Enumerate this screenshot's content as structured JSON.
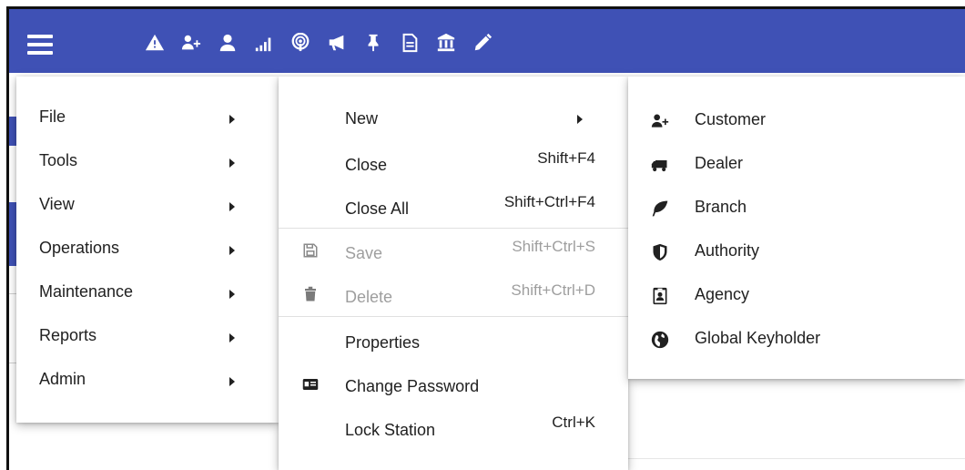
{
  "toolbar": {
    "background": "#3f51b5",
    "icons": [
      "warning-icon",
      "add-user-icon",
      "user-icon",
      "signal-icon",
      "podcast-icon",
      "bullhorn-icon",
      "thumbtack-icon",
      "document-icon",
      "bank-icon",
      "pencil-icon"
    ]
  },
  "main_menu": {
    "items": [
      {
        "label": "File",
        "has_submenu": true
      },
      {
        "label": "Tools",
        "has_submenu": true
      },
      {
        "label": "View",
        "has_submenu": true
      },
      {
        "label": "Operations",
        "has_submenu": true
      },
      {
        "label": "Maintenance",
        "has_submenu": true
      },
      {
        "label": "Reports",
        "has_submenu": true
      },
      {
        "label": "Admin",
        "has_submenu": true
      }
    ]
  },
  "file_menu": {
    "items": [
      {
        "label": "New",
        "shortcut": "",
        "icon": "",
        "disabled": false,
        "has_submenu": true
      },
      {
        "label": "Close",
        "shortcut": "Shift+F4",
        "icon": "",
        "disabled": false
      },
      {
        "label": "Close All",
        "shortcut": "Shift+Ctrl+F4",
        "icon": "",
        "disabled": false
      },
      {
        "label": "Save",
        "shortcut": "Shift+Ctrl+S",
        "icon": "save-icon",
        "disabled": true
      },
      {
        "label": "Delete",
        "shortcut": "Shift+Ctrl+D",
        "icon": "trash-icon",
        "disabled": true
      },
      {
        "label": "Properties",
        "shortcut": "",
        "icon": "",
        "disabled": false
      },
      {
        "label": "Change Password",
        "shortcut": "",
        "icon": "id-card-icon",
        "disabled": false
      },
      {
        "label": "Lock Station",
        "shortcut": "Ctrl+K",
        "icon": "",
        "disabled": false
      }
    ]
  },
  "new_menu": {
    "items": [
      {
        "label": "Customer",
        "icon": "add-user-icon"
      },
      {
        "label": "Dealer",
        "icon": "truck-icon"
      },
      {
        "label": "Branch",
        "icon": "leaf-icon"
      },
      {
        "label": "Authority",
        "icon": "shield-icon"
      },
      {
        "label": "Agency",
        "icon": "badge-icon"
      },
      {
        "label": "Global Keyholder",
        "icon": "globe-icon"
      }
    ]
  }
}
